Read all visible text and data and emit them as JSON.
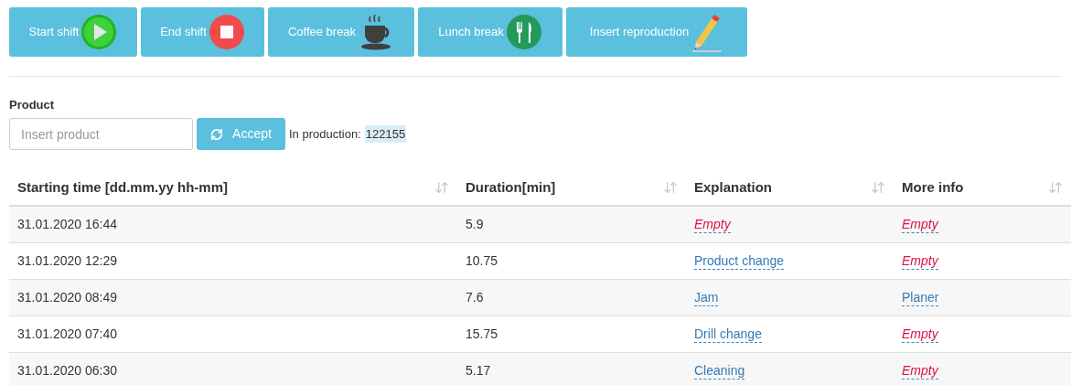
{
  "toolbar": [
    {
      "label": "Start shift",
      "kind": "play"
    },
    {
      "label": "End shift",
      "kind": "stop"
    },
    {
      "label": "Coffee break",
      "kind": "coffee"
    },
    {
      "label": "Lunch break",
      "kind": "lunch"
    },
    {
      "label": "Insert reproduction",
      "kind": "pencil"
    }
  ],
  "product": {
    "label": "Product",
    "placeholder": "Insert product",
    "button": "Accept",
    "status_label": "In production:",
    "status_value": "122155"
  },
  "table": {
    "columns": [
      "Starting time [dd.mm.yy hh-mm]",
      "Duration[min]",
      "Explanation",
      "More info"
    ],
    "rows": [
      {
        "start": "31.01.2020 16:44",
        "duration": "5.9",
        "explanation": {
          "text": "Empty",
          "empty": true
        },
        "more_info": {
          "text": "Empty",
          "empty": true
        }
      },
      {
        "start": "31.01.2020 12:29",
        "duration": "10.75",
        "explanation": {
          "text": "Product change",
          "empty": false
        },
        "more_info": {
          "text": "Empty",
          "empty": true
        }
      },
      {
        "start": "31.01.2020 08:49",
        "duration": "7.6",
        "explanation": {
          "text": "Jam",
          "empty": false
        },
        "more_info": {
          "text": "Planer",
          "empty": false
        }
      },
      {
        "start": "31.01.2020 07:40",
        "duration": "15.75",
        "explanation": {
          "text": "Drill change",
          "empty": false
        },
        "more_info": {
          "text": "Empty",
          "empty": true
        }
      },
      {
        "start": "31.01.2020 06:30",
        "duration": "5.17",
        "explanation": {
          "text": "Cleaning",
          "empty": false
        },
        "more_info": {
          "text": "Empty",
          "empty": true
        }
      }
    ]
  }
}
